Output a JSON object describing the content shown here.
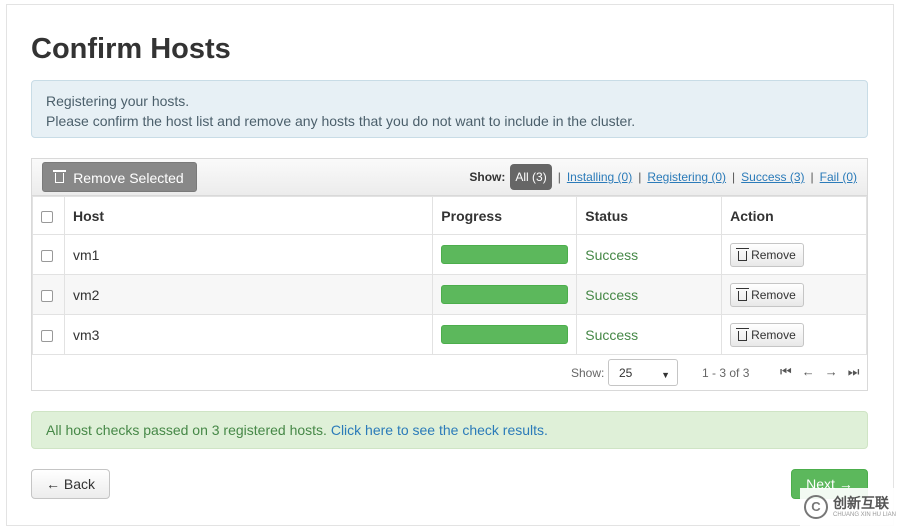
{
  "page": {
    "title": "Confirm Hosts"
  },
  "info": {
    "line1": "Registering your hosts.",
    "line2": "Please confirm the host list and remove any hosts that you do not want to include in the cluster."
  },
  "toolbar": {
    "remove_selected_label": "Remove Selected",
    "show_label": "Show:",
    "filters": [
      {
        "label": "All (3)",
        "active": true
      },
      {
        "label": "Installing (0)"
      },
      {
        "label": "Registering (0)"
      },
      {
        "label": "Success (3)"
      },
      {
        "label": "Fail (0)"
      }
    ]
  },
  "table": {
    "headers": [
      "Host",
      "Progress",
      "Status",
      "Action"
    ],
    "rows": [
      {
        "host": "vm1",
        "progress": 1.0,
        "status": "Success",
        "action": "Remove"
      },
      {
        "host": "vm2",
        "progress": 1.0,
        "status": "Success",
        "action": "Remove"
      },
      {
        "host": "vm3",
        "progress": 1.0,
        "status": "Success",
        "action": "Remove"
      }
    ]
  },
  "pagination": {
    "show_label": "Show:",
    "page_size": "25",
    "range_text": "1 - 3 of 3"
  },
  "alert": {
    "text": "All host checks passed on 3 registered hosts.",
    "link": "Click here to see the check results."
  },
  "nav": {
    "back_label": "← Back",
    "next_label": "Next →"
  },
  "watermark": {
    "main": "创新互联",
    "sub": "CHUANG XIN HU LIAN"
  },
  "colors": {
    "success": "#5cb85c",
    "info_bg": "#e7f0f5",
    "link": "#2b7bb9",
    "alert_bg": "#dff0d8"
  }
}
